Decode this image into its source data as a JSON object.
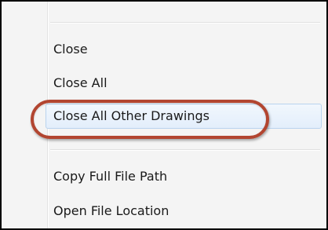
{
  "menu": {
    "items": [
      {
        "label": "Close"
      },
      {
        "label": "Close All"
      },
      {
        "label": "Close All Other Drawings",
        "highlighted": true
      },
      {
        "label": "Copy Full File Path"
      },
      {
        "label": "Open File Location"
      }
    ]
  },
  "annotation": {
    "color": "#b24530"
  }
}
